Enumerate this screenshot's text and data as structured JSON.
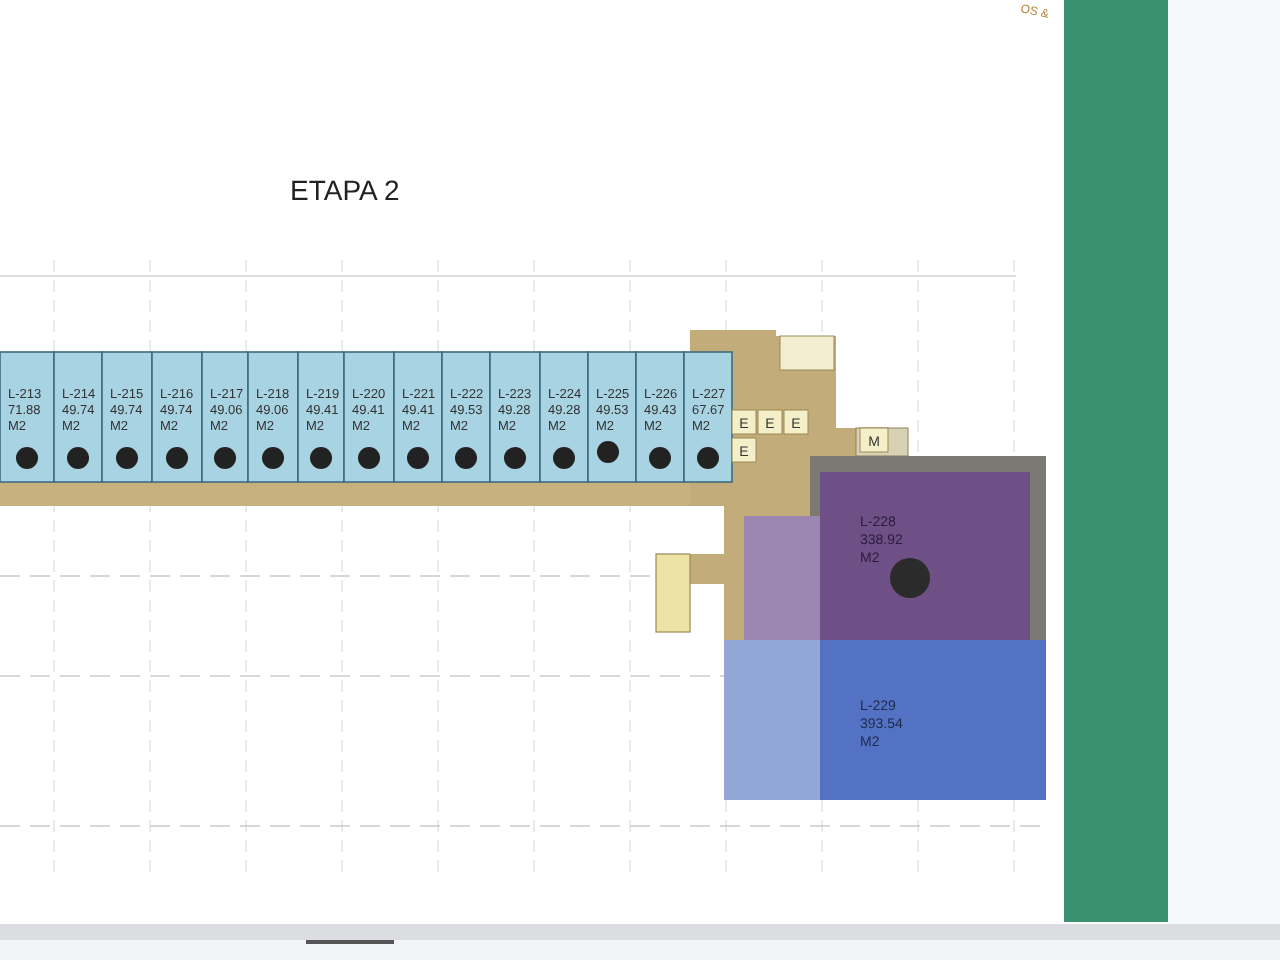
{
  "plan": {
    "title": "ETAPA 2",
    "units": [
      {
        "name": "L-213",
        "area": "71.88",
        "unit": "M2"
      },
      {
        "name": "L-214",
        "area": "49.74",
        "unit": "M2"
      },
      {
        "name": "L-215",
        "area": "49.74",
        "unit": "M2"
      },
      {
        "name": "L-216",
        "area": "49.74",
        "unit": "M2"
      },
      {
        "name": "L-217",
        "area": "49.06",
        "unit": "M2"
      },
      {
        "name": "L-218",
        "area": "49.06",
        "unit": "M2"
      },
      {
        "name": "L-219",
        "area": "49.41",
        "unit": "M2"
      },
      {
        "name": "L-220",
        "area": "49.41",
        "unit": "M2"
      },
      {
        "name": "L-221",
        "area": "49.41",
        "unit": "M2"
      },
      {
        "name": "L-222",
        "area": "49.53",
        "unit": "M2"
      },
      {
        "name": "L-223",
        "area": "49.28",
        "unit": "M2"
      },
      {
        "name": "L-224",
        "area": "49.28",
        "unit": "M2"
      },
      {
        "name": "L-225",
        "area": "49.53",
        "unit": "M2"
      },
      {
        "name": "L-226",
        "area": "49.43",
        "unit": "M2"
      },
      {
        "name": "L-227",
        "area": "67.67",
        "unit": "M2"
      }
    ],
    "large_units": [
      {
        "name": "L-228",
        "area": "338.92",
        "unit": "M2",
        "color": "#6e4f86"
      },
      {
        "name": "L-229",
        "area": "393.54",
        "unit": "M2",
        "color": "#5472c4"
      }
    ],
    "service_rooms": [
      "E",
      "E",
      "E",
      "E",
      "M"
    ]
  },
  "logo_fragment": "OS &"
}
